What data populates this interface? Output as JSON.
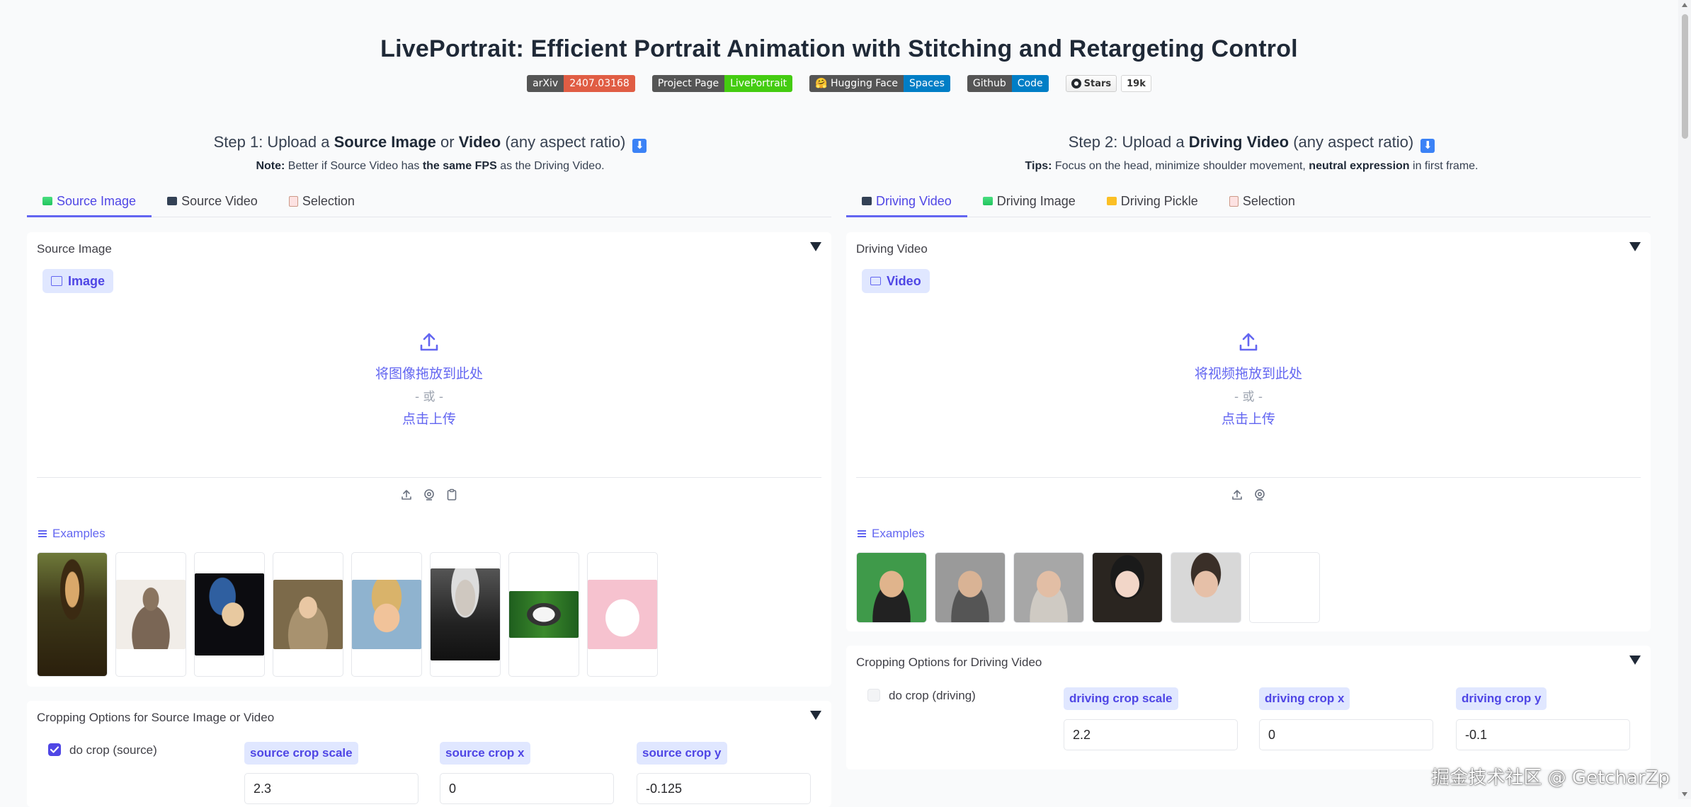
{
  "header": {
    "title": "LivePortrait: Efficient Portrait Animation with Stitching and Retargeting Control",
    "badges": [
      {
        "left": "arXiv",
        "right": "2407.03168",
        "color": "#e05d44"
      },
      {
        "left": "Project Page",
        "right": "LivePortrait",
        "color": "#4c1"
      },
      {
        "left": "🤗 Hugging Face",
        "right": "Spaces",
        "color": "#007ec6"
      },
      {
        "left": "Github",
        "right": "Code",
        "color": "#007ec6"
      }
    ],
    "stars_label": "Stars",
    "stars_count": "19k"
  },
  "step1": {
    "title_a": "Step 1: Upload a ",
    "title_b": "Source Image",
    "title_c": " or ",
    "title_d": "Video",
    "title_e": " (any aspect ratio)",
    "note_a": "Note:",
    "note_b": " Better if Source Video has ",
    "note_c": "the same FPS",
    "note_d": " as the Driving Video.",
    "tabs": [
      "Source Image",
      "Source Video",
      "Selection"
    ],
    "panel_label": "Source Image",
    "chip_label": "Image",
    "drop_text": "将图像拖放到此处",
    "or_text": "- 或 -",
    "click_text": "点击上传",
    "examples_label": "Examples",
    "crop_title": "Cropping Options for Source Image or Video",
    "do_crop_label": "do crop (source)",
    "do_crop_checked": true,
    "fields": [
      {
        "label": "source crop scale",
        "value": "2.3"
      },
      {
        "label": "source crop x",
        "value": "0"
      },
      {
        "label": "source crop y",
        "value": "-0.125"
      }
    ]
  },
  "step2": {
    "title_a": "Step 2: Upload a ",
    "title_b": "Driving Video",
    "title_c": " (any aspect ratio)",
    "tips_a": "Tips:",
    "tips_b": " Focus on the head, minimize shoulder movement, ",
    "tips_c": "neutral expression",
    "tips_d": " in first frame.",
    "tabs": [
      "Driving Video",
      "Driving Image",
      "Driving Pickle",
      "Selection"
    ],
    "panel_label": "Driving Video",
    "chip_label": "Video",
    "drop_text": "将视频拖放到此处",
    "or_text": "- 或 -",
    "click_text": "点击上传",
    "examples_label": "Examples",
    "crop_title": "Cropping Options for Driving Video",
    "do_crop_label": "do crop (driving)",
    "do_crop_checked": false,
    "fields": [
      {
        "label": "driving crop scale",
        "value": "2.2"
      },
      {
        "label": "driving crop x",
        "value": "0"
      },
      {
        "label": "driving crop y",
        "value": "-0.1"
      }
    ]
  },
  "watermark": "掘金技术社区 @ GetcharZp",
  "colors": {
    "accent": "#6366f1",
    "accent_bg": "#e0e7ff",
    "checkbox": "#4f46e5"
  }
}
